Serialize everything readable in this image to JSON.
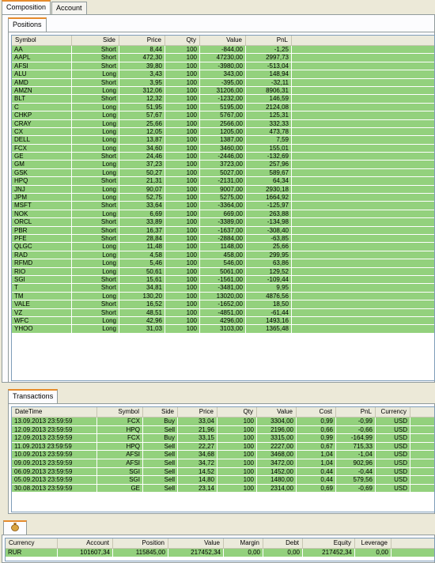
{
  "top_tabs": [
    "Composition",
    "Account"
  ],
  "positions_tab": "Positions",
  "positions": {
    "columns": [
      "Symbol",
      "Side",
      "Price",
      "Qty",
      "Value",
      "PnL"
    ],
    "rows": [
      [
        "AA",
        "Short",
        "8,44",
        "100",
        "-844,00",
        "-1,25"
      ],
      [
        "AAPL",
        "Short",
        "472,30",
        "100",
        "47230,00",
        "2997,73"
      ],
      [
        "AFSI",
        "Short",
        "39,80",
        "100",
        "-3980,00",
        "-513,04"
      ],
      [
        "ALU",
        "Long",
        "3,43",
        "100",
        "343,00",
        "148,94"
      ],
      [
        "AMD",
        "Short",
        "3,95",
        "100",
        "-395,00",
        "-32,11"
      ],
      [
        "AMZN",
        "Long",
        "312,06",
        "100",
        "31206,00",
        "8906,31"
      ],
      [
        "BLT",
        "Short",
        "12,32",
        "100",
        "-1232,00",
        "146,59"
      ],
      [
        "C",
        "Long",
        "51,95",
        "100",
        "5195,00",
        "2124,08"
      ],
      [
        "CHKP",
        "Long",
        "57,67",
        "100",
        "5767,00",
        "125,31"
      ],
      [
        "CRAY",
        "Long",
        "25,66",
        "100",
        "2566,00",
        "332,33"
      ],
      [
        "CX",
        "Long",
        "12,05",
        "100",
        "1205,00",
        "473,78"
      ],
      [
        "DELL",
        "Long",
        "13,87",
        "100",
        "1387,00",
        "7,59"
      ],
      [
        "FCX",
        "Long",
        "34,60",
        "100",
        "3460,00",
        "155,01"
      ],
      [
        "GE",
        "Short",
        "24,46",
        "100",
        "-2446,00",
        "-132,69"
      ],
      [
        "GM",
        "Long",
        "37,23",
        "100",
        "3723,00",
        "257,96"
      ],
      [
        "GSK",
        "Long",
        "50,27",
        "100",
        "5027,00",
        "589,67"
      ],
      [
        "HPQ",
        "Short",
        "21,31",
        "100",
        "-2131,00",
        "64,34"
      ],
      [
        "JNJ",
        "Long",
        "90,07",
        "100",
        "9007,00",
        "2930,18"
      ],
      [
        "JPM",
        "Long",
        "52,75",
        "100",
        "5275,00",
        "1664,92"
      ],
      [
        "MSFT",
        "Short",
        "33,64",
        "100",
        "-3364,00",
        "-125,97"
      ],
      [
        "NOK",
        "Long",
        "6,69",
        "100",
        "669,00",
        "263,88"
      ],
      [
        "ORCL",
        "Short",
        "33,89",
        "100",
        "-3389,00",
        "-134,98"
      ],
      [
        "PBR",
        "Short",
        "16,37",
        "100",
        "-1637,00",
        "-308,40"
      ],
      [
        "PFE",
        "Short",
        "28,84",
        "100",
        "-2884,00",
        "-63,85"
      ],
      [
        "QLGC",
        "Long",
        "11,48",
        "100",
        "1148,00",
        "25,66"
      ],
      [
        "RAD",
        "Long",
        "4,58",
        "100",
        "458,00",
        "299,95"
      ],
      [
        "RFMD",
        "Long",
        "5,46",
        "100",
        "546,00",
        "63,86"
      ],
      [
        "RIO",
        "Long",
        "50,61",
        "100",
        "5061,00",
        "129,52"
      ],
      [
        "SGI",
        "Short",
        "15,61",
        "100",
        "-1561,00",
        "-109,44"
      ],
      [
        "T",
        "Short",
        "34,81",
        "100",
        "-3481,00",
        "9,95"
      ],
      [
        "TM",
        "Long",
        "130,20",
        "100",
        "13020,00",
        "4876,56"
      ],
      [
        "VALE",
        "Short",
        "16,52",
        "100",
        "-1652,00",
        "18,50"
      ],
      [
        "VZ",
        "Short",
        "48,51",
        "100",
        "-4851,00",
        "-61,44"
      ],
      [
        "WFC",
        "Long",
        "42,96",
        "100",
        "4296,00",
        "1493,16"
      ],
      [
        "YHOO",
        "Long",
        "31,03",
        "100",
        "3103,00",
        "1365,48"
      ]
    ]
  },
  "transactions_tab": "Transactions",
  "transactions": {
    "columns": [
      "DateTime",
      "Symbol",
      "Side",
      "Price",
      "Qty",
      "Value",
      "Cost",
      "PnL",
      "Currency"
    ],
    "rows": [
      [
        "13.09.2013 23:59:59",
        "FCX",
        "Buy",
        "33,04",
        "100",
        "3304,00",
        "0,99",
        "-0,99",
        "USD"
      ],
      [
        "12.09.2013 23:59:59",
        "HPQ",
        "Sell",
        "21,96",
        "100",
        "2196,00",
        "0,66",
        "-0,66",
        "USD"
      ],
      [
        "12.09.2013 23:59:59",
        "FCX",
        "Buy",
        "33,15",
        "100",
        "3315,00",
        "0,99",
        "-164,99",
        "USD"
      ],
      [
        "11.09.2013 23:59:59",
        "HPQ",
        "Sell",
        "22,27",
        "100",
        "2227,00",
        "0,67",
        "715,33",
        "USD"
      ],
      [
        "10.09.2013 23:59:59",
        "AFSI",
        "Sell",
        "34,68",
        "100",
        "3468,00",
        "1,04",
        "-1,04",
        "USD"
      ],
      [
        "09.09.2013 23:59:59",
        "AFSI",
        "Sell",
        "34,72",
        "100",
        "3472,00",
        "1,04",
        "902,96",
        "USD"
      ],
      [
        "06.09.2013 23:59:59",
        "SGI",
        "Sell",
        "14,52",
        "100",
        "1452,00",
        "0,44",
        "-0,44",
        "USD"
      ],
      [
        "05.09.2013 23:59:59",
        "SGI",
        "Sell",
        "14,80",
        "100",
        "1480,00",
        "0,44",
        "579,56",
        "USD"
      ],
      [
        "30.08.2013 23:59:59",
        "GE",
        "Sell",
        "23,14",
        "100",
        "2314,00",
        "0,69",
        "-0,69",
        "USD"
      ]
    ]
  },
  "account": {
    "columns": [
      "Currency",
      "Account",
      "Position",
      "Value",
      "Margin",
      "Debt",
      "Equity",
      "Leverage"
    ],
    "rows": [
      [
        "RUR",
        "101607,34",
        "115845,00",
        "217452,34",
        "0,00",
        "0,00",
        "217452,34",
        "0,00"
      ]
    ]
  },
  "colors": {
    "row_green": "#93d17d",
    "tab_accent": "#e68b2c"
  },
  "icons": {
    "bottom_tab": "money-bag-icon"
  }
}
